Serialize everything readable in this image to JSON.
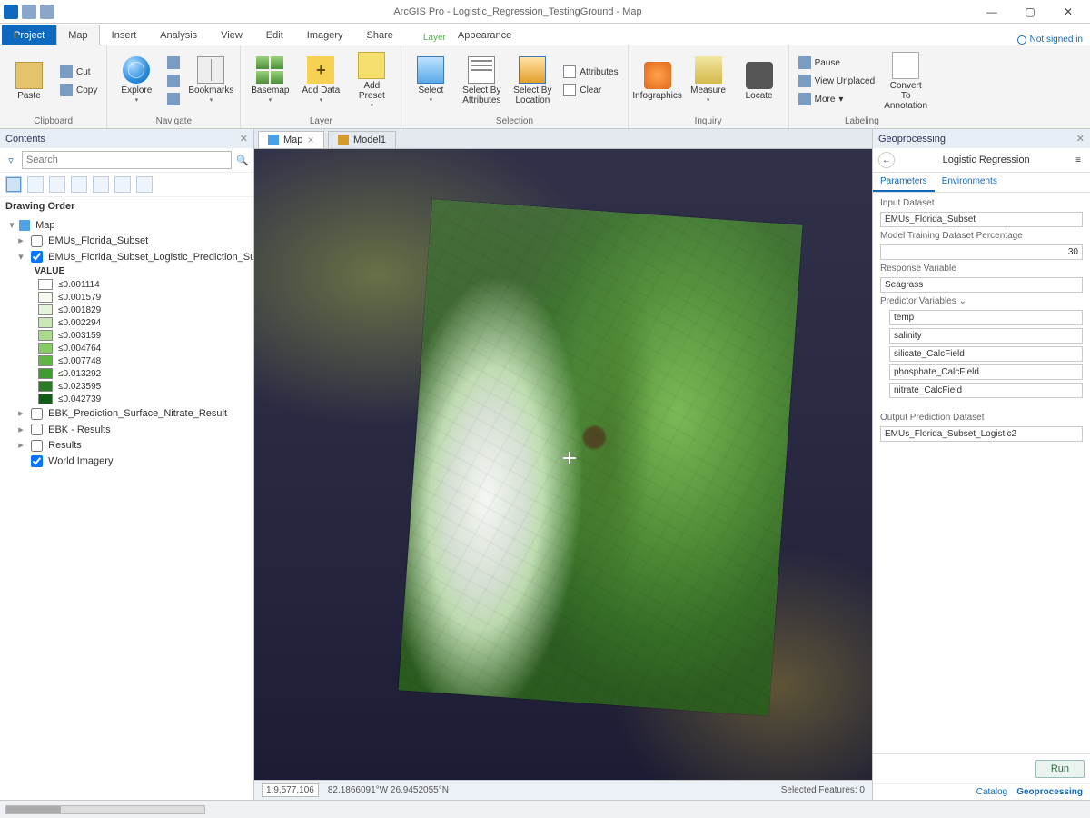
{
  "app": {
    "title": "ArcGIS Pro - Logistic_Regression_TestingGround - Map",
    "signin": "Not signed in"
  },
  "tabs": {
    "project": "Project",
    "list": [
      "Map",
      "Insert",
      "Analysis",
      "View",
      "Edit",
      "Imagery",
      "Share",
      "Appearance"
    ],
    "active": "Map",
    "context_group": "Layer"
  },
  "ribbon": {
    "clipboard": {
      "label": "Clipboard",
      "paste": "Paste",
      "cut": "Cut",
      "copy": "Copy"
    },
    "navigate": {
      "label": "Navigate",
      "explore": "Explore",
      "bookmarks": "Bookmarks"
    },
    "layer": {
      "label": "Layer",
      "basemap": "Basemap",
      "add_data": "Add Data",
      "add_preset": "Add Preset"
    },
    "selection": {
      "label": "Selection",
      "select": "Select",
      "by_attr": "Select By Attributes",
      "by_loc": "Select By Location",
      "attributes": "Attributes",
      "clear": "Clear"
    },
    "inquiry": {
      "label": "Inquiry",
      "infographics": "Infographics",
      "measure": "Measure",
      "locate": "Locate"
    },
    "labeling": {
      "label": "Labeling",
      "pause": "Pause",
      "view_unplaced": "View Unplaced",
      "more": "More",
      "convert": "Convert To Annotation"
    }
  },
  "contents": {
    "pane": "Contents",
    "search_ph": "Search",
    "heading": "Drawing Order",
    "map_name": "Map",
    "layers": {
      "emu": "EMUs_Florida_Subset",
      "pred": "EMUs_Florida_Subset_Logistic_Prediction_Surfa",
      "value": "VALUE",
      "ebk_nitrate": "EBK_Prediction_Surface_Nitrate_Result",
      "ebk_results": "EBK - Results",
      "results": "Results",
      "world": "World Imagery"
    },
    "legend": [
      {
        "label": "≤0.001114",
        "c": "#ffffff"
      },
      {
        "label": "≤0.001579",
        "c": "#f4faf0"
      },
      {
        "label": "≤0.001829",
        "c": "#e4f3d9"
      },
      {
        "label": "≤0.002294",
        "c": "#c9e8b5"
      },
      {
        "label": "≤0.003159",
        "c": "#a8db8c"
      },
      {
        "label": "≤0.004764",
        "c": "#84cc63"
      },
      {
        "label": "≤0.007748",
        "c": "#5fb644"
      },
      {
        "label": "≤0.013292",
        "c": "#3f9c32"
      },
      {
        "label": "≤0.023595",
        "c": "#267d23"
      },
      {
        "label": "≤0.042739",
        "c": "#115c16"
      }
    ]
  },
  "maptabs": {
    "map": "Map",
    "model": "Model1"
  },
  "mapstatus": {
    "scale": "1:9,577,106",
    "coords": "82.1866091°W 26.9452055°N",
    "selected": "Selected Features: 0"
  },
  "gp": {
    "pane": "Geoprocessing",
    "tool": "Logistic Regression",
    "tabs": {
      "params": "Parameters",
      "env": "Environments"
    },
    "labels": {
      "input": "Input Dataset",
      "pct": "Model Training Dataset Percentage",
      "resp": "Response Variable",
      "pred": "Predictor Variables",
      "out": "Output Prediction Dataset"
    },
    "values": {
      "input": "EMUs_Florida_Subset",
      "pct": "30",
      "resp": "Seagrass",
      "vars": [
        "temp",
        "salinity",
        "silicate_CalcField",
        "phosphate_CalcField",
        "nitrate_CalcField"
      ],
      "out": "EMUs_Florida_Subset_Logistic2"
    },
    "run": "Run",
    "bottom": {
      "catalog": "Catalog",
      "gp": "Geoprocessing"
    }
  }
}
